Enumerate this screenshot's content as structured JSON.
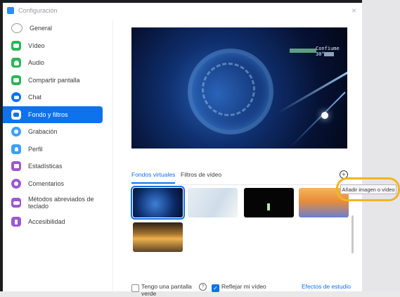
{
  "window": {
    "title": "Configuración",
    "close": "×"
  },
  "sidebar": {
    "items": [
      {
        "label": "General",
        "icon": "general-icon",
        "color": "#c9c9cc"
      },
      {
        "label": "Vídeo",
        "icon": "video-icon",
        "color": "#2eb459"
      },
      {
        "label": "Audio",
        "icon": "headphones-icon",
        "color": "#2eb459"
      },
      {
        "label": "Compartir pantalla",
        "icon": "share-screen-icon",
        "color": "#2eb459"
      },
      {
        "label": "Chat",
        "icon": "chat-icon",
        "color": "#0e72ed"
      },
      {
        "label": "Fondo y filtros",
        "icon": "background-icon",
        "color": "#ffffff",
        "active": true
      },
      {
        "label": "Grabación",
        "icon": "record-icon",
        "color": "#3aa0ff"
      },
      {
        "label": "Perfil",
        "icon": "profile-icon",
        "color": "#3aa0ff"
      },
      {
        "label": "Estadísticas",
        "icon": "statistics-icon",
        "color": "#9b59d0"
      },
      {
        "label": "Comentarios",
        "icon": "feedback-icon",
        "color": "#9b59d0"
      },
      {
        "label": "Métodos abreviados de teclado",
        "icon": "keyboard-icon",
        "color": "#9b59d0"
      },
      {
        "label": "Accesibilidad",
        "icon": "accessibility-icon",
        "color": "#9b59d0"
      }
    ]
  },
  "preview": {
    "hud_text": "Confiume 30°"
  },
  "tabs": [
    {
      "label": "Fondos virtuales",
      "active": true
    },
    {
      "label": "Filtros de vídeo",
      "active": false
    }
  ],
  "add_button": {
    "symbol": "+"
  },
  "tooltip": {
    "text": "Añadir imagen o vídeo"
  },
  "footer": {
    "green_screen_label": "Tengo una pantalla verde",
    "green_screen_checked": false,
    "help_symbol": "?",
    "mirror_label": "Reflejar mi vídeo",
    "mirror_checked": true,
    "mirror_check_symbol": "✓",
    "studio_effects": "Efectos de estudio"
  }
}
